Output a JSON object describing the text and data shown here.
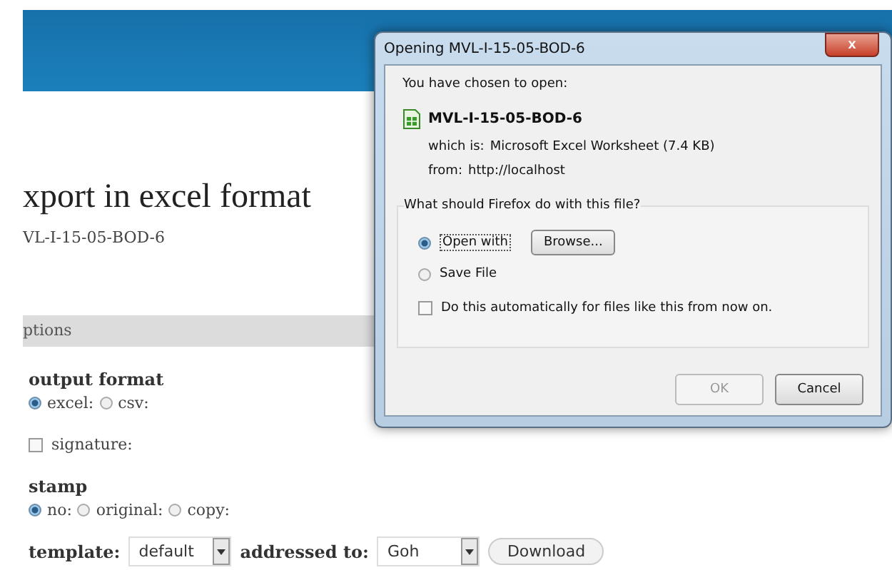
{
  "page": {
    "title": "xport in excel format",
    "subtitle": "VL-I-15-05-BOD-6",
    "section": "ptions",
    "groups": [
      {
        "kind": "radios",
        "label": "output format",
        "options": [
          {
            "label": "excel:",
            "selected": true
          },
          {
            "label": "csv:",
            "selected": false
          }
        ]
      },
      {
        "kind": "checkbox",
        "label": "signature:",
        "checked": false
      },
      {
        "kind": "radios",
        "label": "stamp",
        "options": [
          {
            "label": "no:",
            "selected": true
          },
          {
            "label": "original:",
            "selected": false
          },
          {
            "label": "copy:",
            "selected": false
          }
        ]
      }
    ],
    "template": {
      "label": "template:",
      "value": "default"
    },
    "addressed": {
      "label": "addressed to:",
      "value": "Goh"
    },
    "download": "Download"
  },
  "dialog": {
    "title": "Opening MVL-I-15-05-BOD-6",
    "close": "x",
    "intro": "You have chosen to open:",
    "filename": "MVL-I-15-05-BOD-6",
    "which_label": "which is:",
    "which_value": "Microsoft Excel Worksheet (7.4 KB)",
    "from_label": "from:",
    "from_value": "http://localhost",
    "question": "What should Firefox do with this file?",
    "actions": [
      {
        "label": "Open with",
        "selected": true
      },
      {
        "label": "Save File",
        "selected": false
      }
    ],
    "browse": "Browse...",
    "auto": {
      "label": "Do this automatically for files like this from now on.",
      "checked": false
    },
    "buttons": [
      {
        "label": "OK",
        "disabled": true
      },
      {
        "label": "Cancel",
        "disabled": false
      }
    ]
  }
}
